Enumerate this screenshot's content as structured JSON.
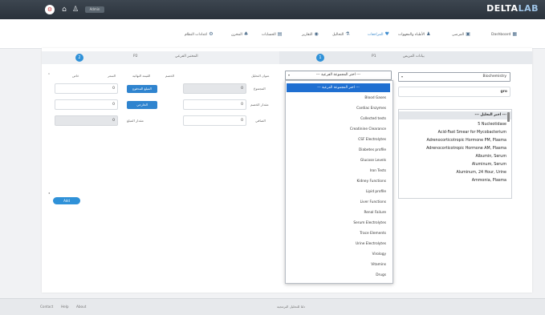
{
  "topbar": {
    "logo_main": "DELTA",
    "logo_accent": "LAB",
    "user_chip": "Admin",
    "icons": [
      "settings-icon",
      "home-icon",
      "user-icon"
    ]
  },
  "nav": {
    "items": [
      {
        "label": "Dashboard",
        "icon": "grid-icon"
      },
      {
        "label": "المرضى",
        "icon": "patients-icon"
      },
      {
        "label": "الأطباء والمعهوات",
        "icon": "doctors-icon"
      },
      {
        "label": "المراجعات",
        "icon": "heart-icon",
        "active": true
      },
      {
        "label": "التحاليل",
        "icon": "flask-icon"
      },
      {
        "label": "التقارير",
        "icon": "report-icon"
      },
      {
        "label": "الحسابات",
        "icon": "accounts-icon"
      },
      {
        "label": "المخزن",
        "icon": "store-icon"
      },
      {
        "label": "اعدادات النظام",
        "icon": "gear-icon"
      }
    ]
  },
  "steps": {
    "left": {
      "num": "2",
      "code": "P2",
      "label": "المختبر الفرعي"
    },
    "right": {
      "num": "1",
      "code": "P1",
      "label": "بيانات المريض"
    }
  },
  "table_headers": {
    "action": "خاص",
    "price": "السعر",
    "final_price": "القيمة النهائية",
    "discount": "الخصم",
    "title": "عنوان التحليل"
  },
  "form": {
    "total_label": "المجموع",
    "discount_label": "مقدار الخصم",
    "net_label": "الصافي",
    "remaining_label": "مقدار المبلغ",
    "total_btn": "المبلغ المدفوع",
    "discount_btn": "الخارجي",
    "row_values": [
      "0",
      "0",
      "0",
      "0",
      "0"
    ],
    "add_button": "Add"
  },
  "group_select": {
    "placeholder": "--- اختر المجموعة الفرعية ---",
    "selected": "--- اختر المجموعة الفرعية ---",
    "options": [
      "Blood Gases",
      "Cardiac Enzymes",
      "Collected tests",
      "Creatinine Clearance",
      "CSF Electrolytes",
      "Diabetes profile",
      "Glucose Levels",
      "Iron Tests",
      "Kidney Functions",
      "Lipid profile",
      "Liver Functions",
      "Renal Failure",
      "Serum Electrolytes",
      "Trace Elements",
      "Urine Electrolytes",
      "Virology",
      "Vitamins",
      "Drugs"
    ]
  },
  "department_select": {
    "value": "Biochemistry",
    "search": "gro"
  },
  "test_list": {
    "header": "--- اختر التحليل ---",
    "items": [
      "5 Nucleotidase",
      "Acid-Fast Smear for Mycobacterium",
      "Adrenocorticotropic Hormone PM, Plasma",
      "Adrenocorticotropic Hormone AM, Plasma",
      "Albumin, Serum",
      "Aluminum, Serum",
      "Aluminum, 24 Hour, Urine",
      "Ammonia, Plasma"
    ]
  },
  "footer": {
    "links": [
      "Contact",
      "Help",
      "About"
    ],
    "center": "دلتا للتحليل البرمجية"
  }
}
